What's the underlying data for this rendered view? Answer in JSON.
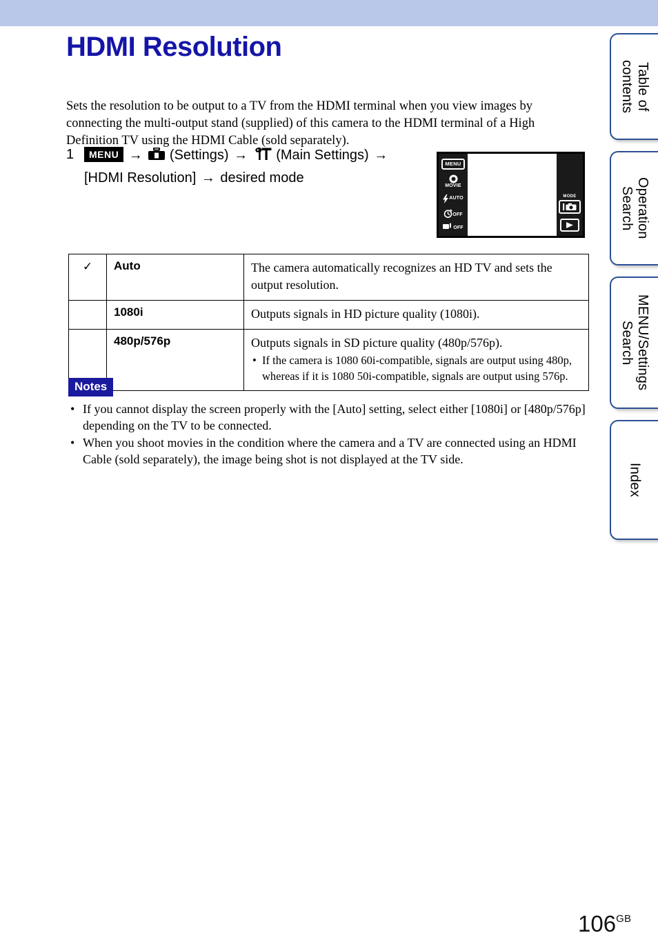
{
  "header": {
    "band_color": "#b9c8e8"
  },
  "page": {
    "title": "HDMI Resolution",
    "title_color": "#1515a8",
    "intro": "Sets the resolution to be output to a TV from the HDMI terminal when you view images by connecting the multi-output stand (supplied) of this camera to the HDMI terminal of a High Definition TV using the HDMI Cable (sold separately).",
    "number": "106",
    "number_suffix": "GB"
  },
  "step": {
    "number": "1",
    "menu_badge": "MENU",
    "arrow": "→",
    "settings_label": "(Settings)",
    "main_settings_label": "(Main Settings)",
    "item_label": "[HDMI Resolution]",
    "final_label": "desired mode"
  },
  "lcd": {
    "menu_button": "MENU",
    "movie_label": "MOVIE",
    "flash_label": "AUTO",
    "timer_label": "OFF",
    "burst_label": "OFF",
    "mode_label": "MODE"
  },
  "table": {
    "check_glyph": "✓",
    "rows": [
      {
        "checked": true,
        "name": "Auto",
        "desc": "The camera automatically recognizes an HD TV and sets the output resolution.",
        "sub": []
      },
      {
        "checked": false,
        "name": "1080i",
        "desc": "Outputs signals in HD picture quality (1080i).",
        "sub": []
      },
      {
        "checked": false,
        "name": "480p/576p",
        "desc": "Outputs signals in SD picture quality (480p/576p).",
        "sub": [
          "If the camera is 1080 60i-compatible, signals are output using 480p, whereas if it is 1080 50i-compatible, signals are output using 576p."
        ]
      }
    ]
  },
  "notes": {
    "badge": "Notes",
    "badge_color": "#1a1a9e",
    "items": [
      "If you cannot display the screen properly with the [Auto] setting, select either [1080i] or [480p/576p] depending on the TV to be connected.",
      "When you shoot movies in the condition where the camera and a TV are connected using an HDMI Cable (sold separately), the image being shot is not displayed at the TV side."
    ]
  },
  "tabs": {
    "border_color": "#2b4f95",
    "items": [
      {
        "label": "Table of\ncontents"
      },
      {
        "label": "Operation\nSearch"
      },
      {
        "label": "MENU/Settings\nSearch"
      },
      {
        "label": "Index"
      }
    ]
  }
}
